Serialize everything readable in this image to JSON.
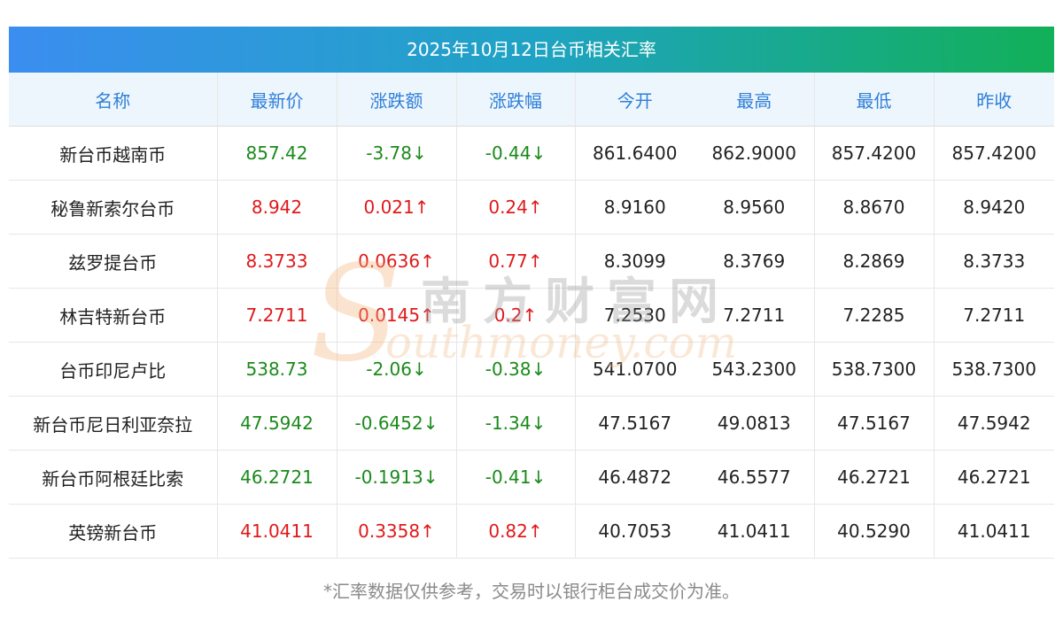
{
  "title": "2025年10月12日台币相关汇率",
  "headers": [
    "名称",
    "最新价",
    "涨跌额",
    "涨跌幅",
    "今开",
    "最高",
    "最低",
    "昨收"
  ],
  "rows": [
    {
      "name": "新台币越南币",
      "latest": "857.42",
      "change": "-3.78↓",
      "pct": "-0.44↓",
      "open": "861.6400",
      "high": "862.9000",
      "low": "857.4200",
      "prev": "857.4200",
      "dir": "down"
    },
    {
      "name": "秘鲁新索尔台币",
      "latest": "8.942",
      "change": "0.021↑",
      "pct": "0.24↑",
      "open": "8.9160",
      "high": "8.9560",
      "low": "8.8670",
      "prev": "8.9420",
      "dir": "up"
    },
    {
      "name": "兹罗提台币",
      "latest": "8.3733",
      "change": "0.0636↑",
      "pct": "0.77↑",
      "open": "8.3099",
      "high": "8.3769",
      "low": "8.2869",
      "prev": "8.3733",
      "dir": "up"
    },
    {
      "name": "林吉特新台币",
      "latest": "7.2711",
      "change": "0.0145↑",
      "pct": "0.2↑",
      "open": "7.2530",
      "high": "7.2711",
      "low": "7.2285",
      "prev": "7.2711",
      "dir": "up"
    },
    {
      "name": "台币印尼卢比",
      "latest": "538.73",
      "change": "-2.06↓",
      "pct": "-0.38↓",
      "open": "541.0700",
      "high": "543.2300",
      "low": "538.7300",
      "prev": "538.7300",
      "dir": "down"
    },
    {
      "name": "新台币尼日利亚奈拉",
      "latest": "47.5942",
      "change": "-0.6452↓",
      "pct": "-1.34↓",
      "open": "47.5167",
      "high": "49.0813",
      "low": "47.5167",
      "prev": "47.5942",
      "dir": "down"
    },
    {
      "name": "新台币阿根廷比索",
      "latest": "46.2721",
      "change": "-0.1913↓",
      "pct": "-0.41↓",
      "open": "46.4872",
      "high": "46.5577",
      "low": "46.2721",
      "prev": "46.2721",
      "dir": "down"
    },
    {
      "name": "英镑新台币",
      "latest": "41.0411",
      "change": "0.3358↑",
      "pct": "0.82↑",
      "open": "40.7053",
      "high": "41.0411",
      "low": "40.5290",
      "prev": "41.0411",
      "dir": "up"
    }
  ],
  "footnote": "*汇率数据仅供参考，交易时以银行柜台成交价为准。",
  "watermark": {
    "letter": "S",
    "cn": "南方财富网",
    "en": "outhmoney.com"
  },
  "colors": {
    "up": "#e0191a",
    "down": "#1a8a1a",
    "header_text": "#2f7fd8"
  }
}
